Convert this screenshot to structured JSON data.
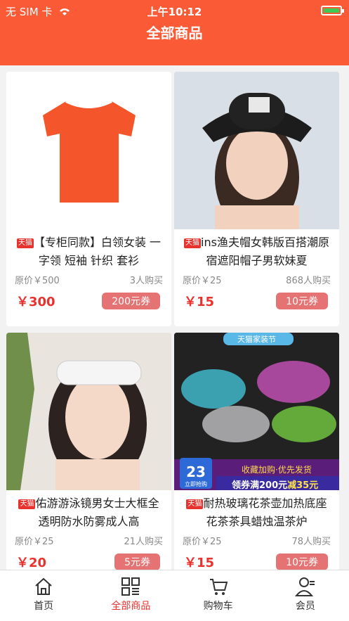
{
  "status": {
    "carrier": "无 SIM 卡",
    "time": "上午10:12"
  },
  "header": {
    "title": "全部商品"
  },
  "products": [
    {
      "badge": "天猫",
      "name": "【专柜同款】白领女装 一字领 短袖 针织 套衫",
      "orig_price": "原价￥500",
      "buyers": "3人购买",
      "price": "￥300",
      "coupon": "200元券"
    },
    {
      "badge": "天猫",
      "name": "ins渔夫帽女韩版百搭潮原宿遮阳帽子男软妹夏",
      "orig_price": "原价￥25",
      "buyers": "868人购买",
      "price": "￥15",
      "coupon": "10元券"
    },
    {
      "badge": "天猫",
      "name": "佑游游泳镜男女士大框全透明防水防雾成人高",
      "orig_price": "原价￥25",
      "buyers": "21人购买",
      "price": "￥20",
      "coupon": "5元券"
    },
    {
      "badge": "天猫",
      "name": "耐热玻璃花茶壶加热底座 花茶茶具蜡烛温茶炉",
      "orig_price": "原价￥25",
      "buyers": "78人购买",
      "price": "￥15",
      "coupon": "10元券",
      "promo": {
        "top": "天猫家装节",
        "date": "23",
        "date_sub": "立即抢购",
        "line1": "收藏加购·优先发货",
        "line2a": "领券满200元",
        "line2b": "减35元"
      }
    }
  ],
  "tabs": [
    {
      "label": "首页",
      "icon": "home-icon"
    },
    {
      "label": "全部商品",
      "icon": "grid-icon"
    },
    {
      "label": "购物车",
      "icon": "cart-icon"
    },
    {
      "label": "会员",
      "icon": "user-icon"
    }
  ]
}
